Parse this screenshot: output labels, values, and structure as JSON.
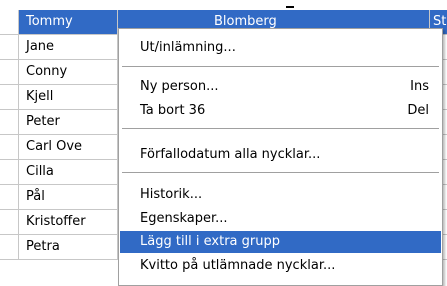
{
  "grid": {
    "rows": [
      {
        "name": "Tommy",
        "surname": "Blomberg",
        "extra": "St",
        "selected": true
      },
      {
        "name": "Jane",
        "surname": "",
        "extra": "",
        "selected": false
      },
      {
        "name": "Conny",
        "surname": "",
        "extra": "",
        "selected": false
      },
      {
        "name": "Kjell",
        "surname": "",
        "extra": "",
        "selected": false
      },
      {
        "name": "Peter",
        "surname": "",
        "extra": "",
        "selected": false
      },
      {
        "name": "Carl Ove",
        "surname": "",
        "extra": "",
        "selected": false
      },
      {
        "name": "Cilla",
        "surname": "",
        "extra": "",
        "selected": false
      },
      {
        "name": "Pål",
        "surname": "",
        "extra": "",
        "selected": false
      },
      {
        "name": "Kristoffer",
        "surname": "",
        "extra": "",
        "selected": false
      },
      {
        "name": "Petra",
        "surname": "",
        "extra": "",
        "selected": false
      }
    ]
  },
  "context_menu": {
    "items": [
      {
        "label": "Ut/inlämning...",
        "shortcut": ""
      },
      {
        "label": "Ny person...",
        "shortcut": "Ins"
      },
      {
        "label": "Ta bort 36",
        "shortcut": "Del"
      },
      {
        "label": "Förfallodatum alla nycklar...",
        "shortcut": ""
      },
      {
        "label": "Historik...",
        "shortcut": ""
      },
      {
        "label": "Egenskaper...",
        "shortcut": ""
      },
      {
        "label": "Lägg till i extra grupp",
        "shortcut": "",
        "highlighted": true
      },
      {
        "label": "Kvitto på utlämnade nycklar...",
        "shortcut": ""
      }
    ]
  },
  "colors": {
    "selection": "#316ac5",
    "grid_line": "#c7c7c7"
  }
}
